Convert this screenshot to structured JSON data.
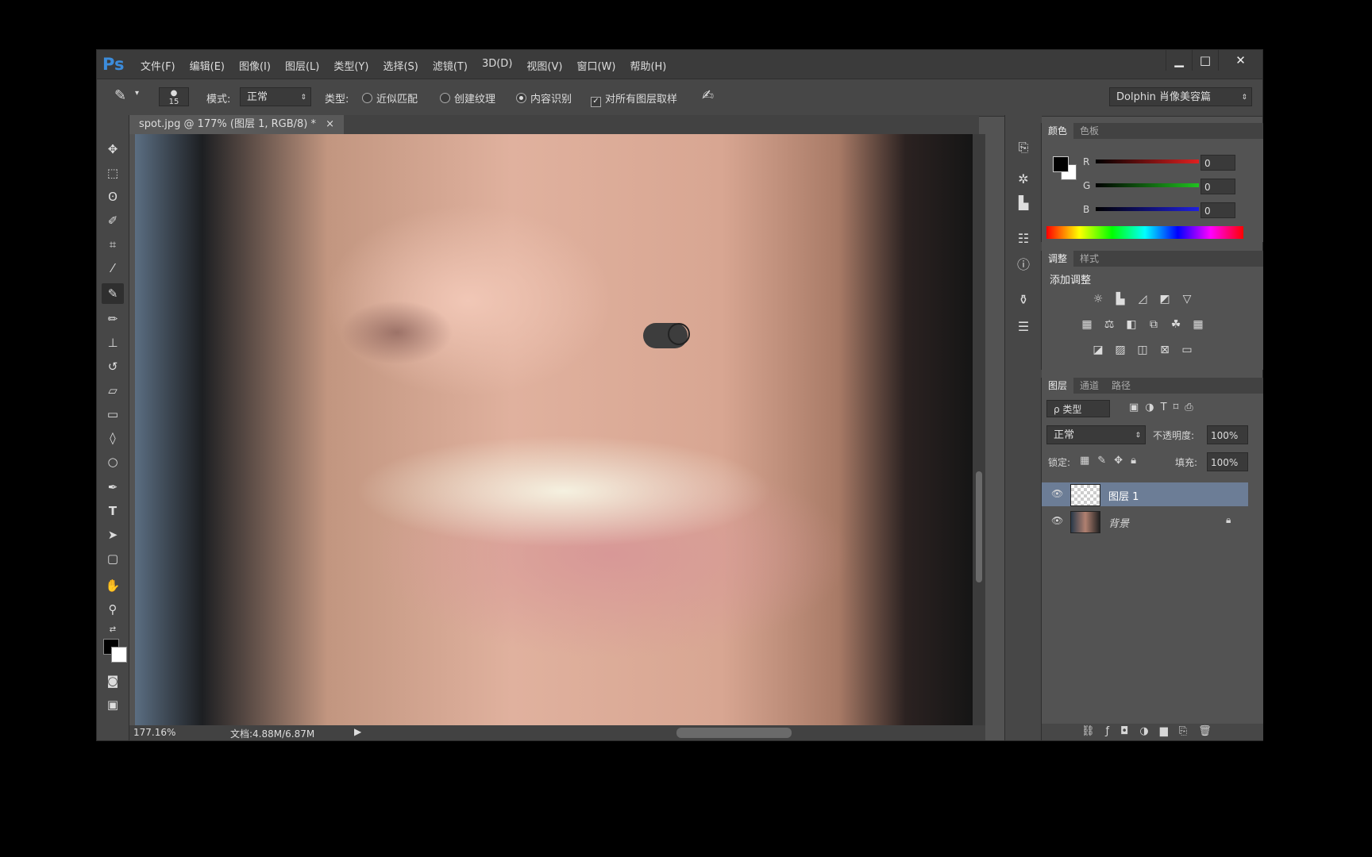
{
  "app": {
    "logo": "Ps"
  },
  "menu": [
    "文件(F)",
    "编辑(E)",
    "图像(I)",
    "图层(L)",
    "类型(Y)",
    "选择(S)",
    "滤镜(T)",
    "3D(D)",
    "视图(V)",
    "窗口(W)",
    "帮助(H)"
  ],
  "window_buttons": {
    "minimize": "▁",
    "maximize": "□",
    "close": "✕"
  },
  "options": {
    "brush_size": "15",
    "mode_label": "模式:",
    "mode_value": "正常",
    "type_label": "类型:",
    "radio_1": "近似匹配",
    "radio_2": "创建纹理",
    "radio_3": "内容识别",
    "checkbox_label": "对所有图层取样",
    "workspace": "Dolphin 肖像美容篇"
  },
  "document": {
    "tab_title": "spot.jpg @ 177% (图层 1, RGB/8) *",
    "tab_close": "×"
  },
  "status": {
    "zoom": "177.16%",
    "doc": "文档:4.88M/6.87M"
  },
  "color_panel": {
    "tabs": [
      "颜色",
      "色板"
    ],
    "channels": [
      {
        "label": "R",
        "value": "0",
        "color": "#e02020"
      },
      {
        "label": "G",
        "value": "0",
        "color": "#20c020"
      },
      {
        "label": "B",
        "value": "0",
        "color": "#2020e0"
      }
    ]
  },
  "adjust_panel": {
    "tabs": [
      "调整",
      "样式"
    ],
    "title": "添加调整"
  },
  "layers_panel": {
    "tabs": [
      "图层",
      "通道",
      "路径"
    ],
    "filter_label": "ρ 类型",
    "blend_mode": "正常",
    "opacity_label": "不透明度:",
    "opacity_value": "100%",
    "lock_label": "锁定:",
    "fill_label": "填充:",
    "fill_value": "100%",
    "layers": [
      {
        "name": "图层 1",
        "selected": true
      },
      {
        "name": "背景",
        "selected": false
      }
    ]
  }
}
